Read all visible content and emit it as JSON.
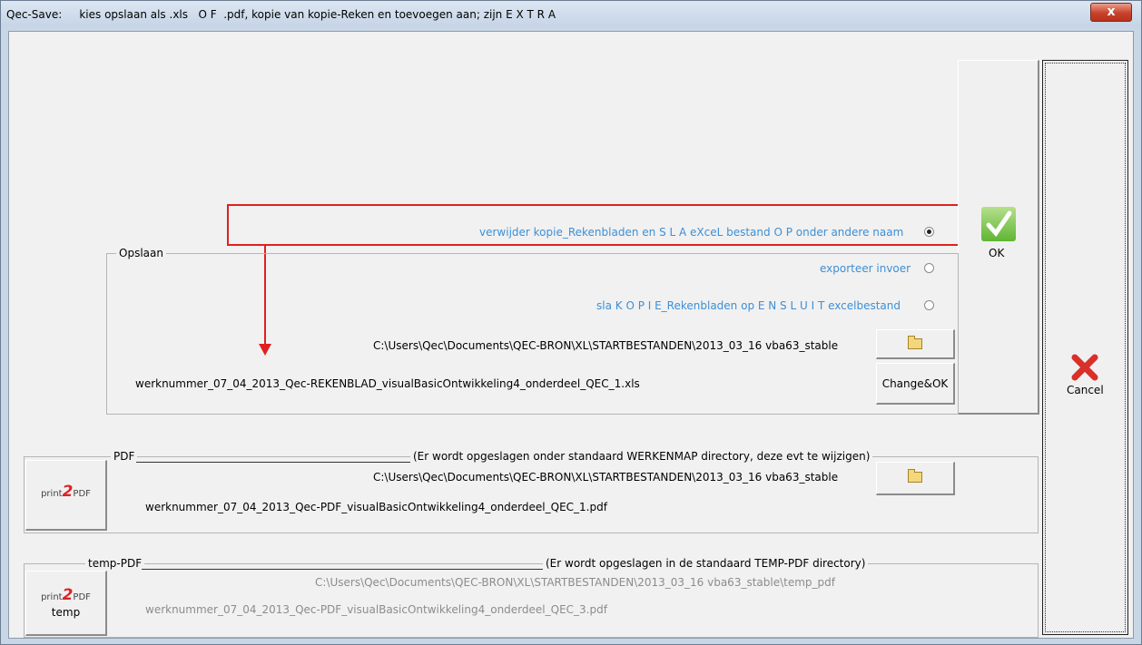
{
  "window": {
    "title_app": "Qec-Save:",
    "title_text": "kies opslaan als .xls   O F  .pdf, kopie van kopie-Reken en toevoegen aan; zijn E X T R A",
    "close_label": "x"
  },
  "options": [
    {
      "label": "verwijder kopie_Rekenbladen en S L A eXceL bestand O P onder andere naam",
      "selected": true
    },
    {
      "label": "exporteer invoer",
      "selected": false
    },
    {
      "label": "sla K O P I E_Rekenbladen op E N  S L U I T excelbestand",
      "selected": false
    }
  ],
  "ok_button": {
    "label": "OK",
    "icon": "checkmark-icon"
  },
  "cancel_button": {
    "label": "Cancel",
    "icon": "red-x-icon"
  },
  "opslaan": {
    "legend": "Opslaan",
    "path": "C:\\Users\\Qec\\Documents\\QEC-BRON\\XL\\STARTBESTANDEN\\2013_03_16 vba63_stable",
    "filename": "werknummer_07_04_2013_Qec-REKENBLAD_visualBasicOntwikkeling4_onderdeel_QEC_1.xls",
    "change_label": "Change&OK"
  },
  "pdf": {
    "legend": "PDF",
    "note": "(Er wordt opgeslagen onder standaard WERKENMAP directory, deze evt te wijzigen)",
    "path": "C:\\Users\\Qec\\Documents\\QEC-BRON\\XL\\STARTBESTANDEN\\2013_03_16 vba63_stable",
    "filename": "werknummer_07_04_2013_Qec-PDF_visualBasicOntwikkeling4_onderdeel_QEC_1.pdf",
    "logo_prefix": "print",
    "logo_num": "2",
    "logo_suffix": "PDF"
  },
  "temp_pdf": {
    "legend": "temp-PDF",
    "note": "(Er wordt opgeslagen in de standaard TEMP-PDF directory)",
    "path": "C:\\Users\\Qec\\Documents\\QEC-BRON\\XL\\STARTBESTANDEN\\2013_03_16 vba63_stable\\temp_pdf",
    "filename": "werknummer_07_04_2013_Qec-PDF_visualBasicOntwikkeling4_onderdeel_QEC_3.pdf",
    "logo_prefix": "print",
    "logo_num": "2",
    "logo_suffix": "PDF",
    "logo_sub": "temp"
  },
  "colors": {
    "highlight": "#e02020",
    "option_text": "#3d8fd6",
    "ok_check": "#5fb532",
    "cancel_x": "#d8302a"
  }
}
